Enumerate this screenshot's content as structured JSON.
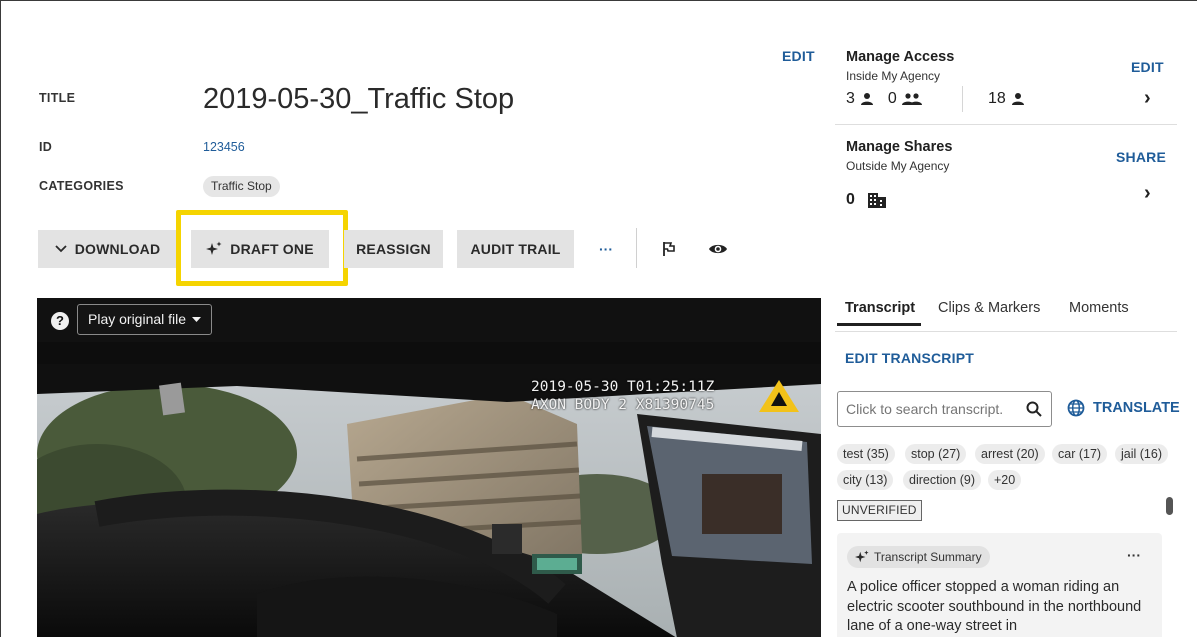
{
  "header": {
    "edit_label": "EDIT"
  },
  "evidence": {
    "title_label": "TITLE",
    "title": "2019-05-30_Traffic Stop",
    "id_label": "ID",
    "id": "123456",
    "categories_label": "CATEGORIES",
    "category": "Traffic Stop"
  },
  "toolbar": {
    "download": "DOWNLOAD",
    "draft_one": "DRAFT ONE",
    "reassign": "REASSIGN",
    "audit_trail": "AUDIT TRAIL",
    "more": "···",
    "highlight_color": "#f5d400"
  },
  "player": {
    "help": "?",
    "play_mode": "Play original file",
    "overlay_line1": "2019-05-30 T01:25:11Z",
    "overlay_line2": "AXON BODY 2 X81390745"
  },
  "access": {
    "title": "Manage Access",
    "subtitle": "Inside My Agency",
    "edit_label": "EDIT",
    "users_count": "3",
    "groups_count": "0",
    "total_count": "18"
  },
  "shares": {
    "title": "Manage Shares",
    "subtitle": "Outside My Agency",
    "share_label": "SHARE",
    "agencies_count": "0"
  },
  "tabs": [
    {
      "label": "Transcript"
    },
    {
      "label": "Clips & Markers"
    },
    {
      "label": "Moments"
    }
  ],
  "transcript": {
    "edit_label": "EDIT TRANSCRIPT",
    "search_placeholder": "Click to search transcript.",
    "translate_label": "TRANSLATE",
    "terms": [
      "test (35)",
      "stop (27)",
      "arrest (20)",
      "car (17)",
      "jail (16)",
      "city (13)",
      "direction (9)",
      "+20"
    ],
    "status": "UNVERIFIED",
    "summary_label": "Transcript Summary",
    "summary_more": "···",
    "summary_text": "A police officer stopped a woman riding an electric scooter southbound in the northbound lane of a one-way street in"
  },
  "colors": {
    "link_blue": "#1f5c99",
    "button_gray": "#e3e3e3"
  }
}
